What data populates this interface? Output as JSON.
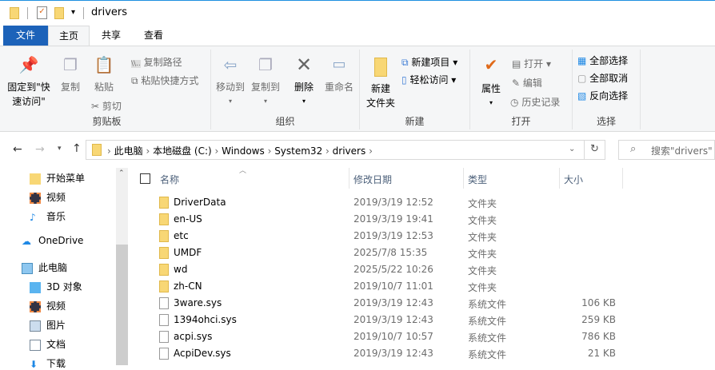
{
  "window": {
    "title": "drivers"
  },
  "tabs": [
    {
      "label": "文件"
    },
    {
      "label": "主页"
    },
    {
      "label": "共享"
    },
    {
      "label": "查看"
    }
  ],
  "ribbon": {
    "clipboard": {
      "label": "剪贴板",
      "pin": "固定到\"快",
      "pin2": "速访问\"",
      "copy": "复制",
      "paste": "粘贴",
      "copy_path": "复制路径",
      "paste_shortcut": "粘贴快捷方式",
      "cut": "剪切"
    },
    "organize": {
      "label": "组织",
      "move_to": "移动到",
      "copy_to": "复制到",
      "delete": "删除",
      "rename": "重命名"
    },
    "new": {
      "label": "新建",
      "new_folder": "新建",
      "new_folder2": "文件夹",
      "new_item": "新建项目",
      "easy_access": "轻松访问"
    },
    "open": {
      "label": "打开",
      "properties": "属性",
      "open": "打开",
      "edit": "编辑",
      "history": "历史记录"
    },
    "select": {
      "label": "选择",
      "select_all": "全部选择",
      "select_none": "全部取消",
      "invert": "反向选择"
    }
  },
  "address": {
    "crumbs": [
      "此电脑",
      "本地磁盘 (C:)",
      "Windows",
      "System32",
      "drivers"
    ]
  },
  "search": {
    "placeholder": "搜索\"drivers\""
  },
  "sidebar": [
    {
      "label": "开始菜单",
      "icon": "folder-icon"
    },
    {
      "label": "视频",
      "icon": "video-icon"
    },
    {
      "label": "音乐",
      "icon": "music-icon"
    },
    {
      "label": "OneDrive",
      "icon": "cloud-icon"
    },
    {
      "label": "此电脑",
      "icon": "pc-icon"
    },
    {
      "label": "3D 对象",
      "icon": "3d-icon"
    },
    {
      "label": "视频",
      "icon": "video-icon"
    },
    {
      "label": "图片",
      "icon": "picture-icon"
    },
    {
      "label": "文档",
      "icon": "document-icon"
    },
    {
      "label": "下载",
      "icon": "download-icon"
    }
  ],
  "columns": {
    "name": "名称",
    "date": "修改日期",
    "type": "类型",
    "size": "大小"
  },
  "files": [
    {
      "name": "DriverData",
      "date": "2019/3/19 12:52",
      "type": "文件夹",
      "size": "",
      "folder": true
    },
    {
      "name": "en-US",
      "date": "2019/3/19 19:41",
      "type": "文件夹",
      "size": "",
      "folder": true
    },
    {
      "name": "etc",
      "date": "2019/3/19 12:53",
      "type": "文件夹",
      "size": "",
      "folder": true
    },
    {
      "name": "UMDF",
      "date": "2025/7/8 15:35",
      "type": "文件夹",
      "size": "",
      "folder": true
    },
    {
      "name": "wd",
      "date": "2025/5/22 10:26",
      "type": "文件夹",
      "size": "",
      "folder": true
    },
    {
      "name": "zh-CN",
      "date": "2019/10/7 11:01",
      "type": "文件夹",
      "size": "",
      "folder": true
    },
    {
      "name": "3ware.sys",
      "date": "2019/3/19 12:43",
      "type": "系统文件",
      "size": "106 KB",
      "folder": false
    },
    {
      "name": "1394ohci.sys",
      "date": "2019/3/19 12:43",
      "type": "系统文件",
      "size": "259 KB",
      "folder": false
    },
    {
      "name": "acpi.sys",
      "date": "2019/10/7 10:57",
      "type": "系统文件",
      "size": "786 KB",
      "folder": false
    },
    {
      "name": "AcpiDev.sys",
      "date": "2019/3/19 12:43",
      "type": "系统文件",
      "size": "21 KB",
      "folder": false
    }
  ]
}
